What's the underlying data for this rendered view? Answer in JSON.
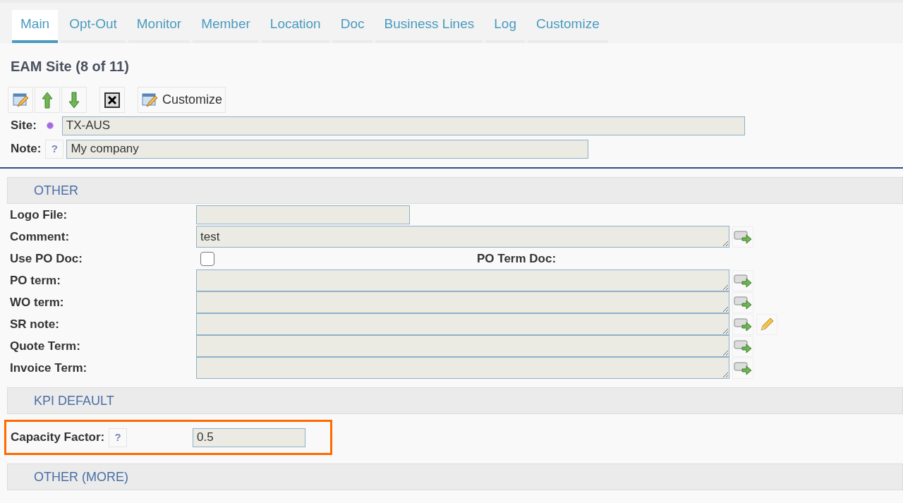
{
  "tabs": [
    {
      "label": "Main",
      "selected": true
    },
    {
      "label": "Opt-Out",
      "selected": false
    },
    {
      "label": "Monitor",
      "selected": false
    },
    {
      "label": "Member",
      "selected": false
    },
    {
      "label": "Location",
      "selected": false
    },
    {
      "label": "Doc",
      "selected": false
    },
    {
      "label": "Business Lines",
      "selected": false
    },
    {
      "label": "Log",
      "selected": false
    },
    {
      "label": "Customize",
      "selected": false
    }
  ],
  "title": "EAM Site (8 of 11)",
  "toolbar": [
    {
      "kind": "edit"
    },
    {
      "kind": "up"
    },
    {
      "kind": "down"
    },
    {
      "kind": "delete"
    },
    {
      "kind": "customize",
      "label": "Customize"
    }
  ],
  "header_fields": [
    {
      "label": "Site:",
      "kind": "required",
      "value": "TX-AUS"
    },
    {
      "label": "Note:",
      "kind": "help",
      "help": "?",
      "value": "My company"
    }
  ],
  "sections": [
    {
      "title": "OTHER",
      "rows": [
        {
          "kind": "input",
          "label": "Logo File:"
        },
        {
          "kind": "textarea",
          "label": "Comment:",
          "value": "test"
        },
        {
          "kind": "checkbox",
          "label": "Use PO Doc:",
          "checked": false,
          "side_label": "PO Term Doc:"
        },
        {
          "kind": "textarea",
          "label": "PO term:"
        },
        {
          "kind": "textarea",
          "label": "WO term:"
        },
        {
          "kind": "textarea",
          "label": "SR note:",
          "pencil": true
        },
        {
          "kind": "textarea",
          "label": "Quote Term:"
        },
        {
          "kind": "textarea",
          "label": "Invoice Term:"
        }
      ]
    },
    {
      "title": "KPI DEFAULT",
      "rows": [
        {
          "kind": "input",
          "label": "Capacity Factor:",
          "help": "?",
          "value": "0.5",
          "highlighted": true
        }
      ]
    },
    {
      "title": "OTHER (MORE)"
    }
  ]
}
